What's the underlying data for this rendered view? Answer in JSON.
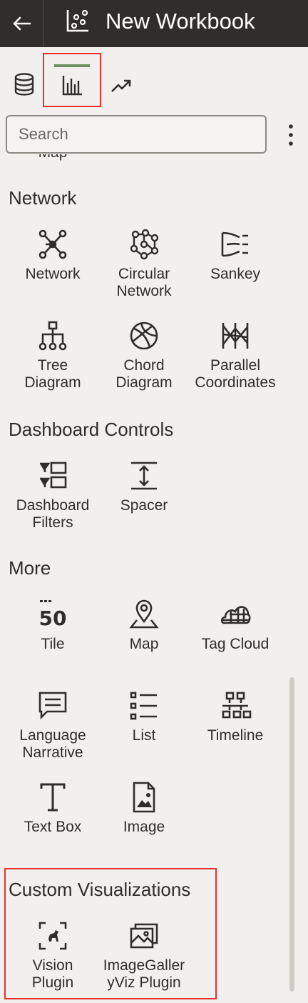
{
  "header": {
    "title": "New Workbook"
  },
  "tabs": [
    {
      "name": "data",
      "icon": "database-icon"
    },
    {
      "name": "visualizations",
      "icon": "bar-chart-icon",
      "active": true
    },
    {
      "name": "analytics",
      "icon": "trend-icon"
    }
  ],
  "search": {
    "placeholder": "Search"
  },
  "cut_item": {
    "label": "Map"
  },
  "sections": {
    "network": {
      "title": "Network",
      "items": [
        {
          "label": "Network",
          "icon": "network-icon"
        },
        {
          "label": "Circular\nNetwork",
          "icon": "circular-network-icon"
        },
        {
          "label": "Sankey",
          "icon": "sankey-icon"
        },
        {
          "label": "Tree\nDiagram",
          "icon": "tree-diagram-icon"
        },
        {
          "label": "Chord\nDiagram",
          "icon": "chord-diagram-icon"
        },
        {
          "label": "Parallel\nCoordinates",
          "icon": "parallel-coordinates-icon"
        }
      ]
    },
    "dashboard": {
      "title": "Dashboard Controls",
      "items": [
        {
          "label": "Dashboard\nFilters",
          "icon": "dashboard-filters-icon"
        },
        {
          "label": "Spacer",
          "icon": "spacer-icon"
        }
      ]
    },
    "more": {
      "title": "More",
      "items": [
        {
          "label": "Tile",
          "icon": "tile-icon",
          "icon_text": "50"
        },
        {
          "label": "Map",
          "icon": "map-pin-icon"
        },
        {
          "label": "Tag Cloud",
          "icon": "tag-cloud-icon"
        },
        {
          "label": "Language\nNarrative",
          "icon": "language-narrative-icon"
        },
        {
          "label": "List",
          "icon": "list-icon"
        },
        {
          "label": "Timeline",
          "icon": "timeline-icon"
        },
        {
          "label": "Text Box",
          "icon": "text-box-icon"
        },
        {
          "label": "Image",
          "icon": "image-icon"
        }
      ]
    },
    "custom": {
      "title": "Custom Visualizations",
      "items": [
        {
          "label": "Vision\nPlugin",
          "icon": "vision-plugin-icon"
        },
        {
          "label": "ImageGaller\nyViz Plugin",
          "icon": "image-gallery-icon"
        }
      ]
    }
  },
  "colors": {
    "header_bg": "#312d2a",
    "background": "#f1f0ee",
    "active_tab_bar": "#6c8e5f",
    "highlight": "#e8322e"
  }
}
